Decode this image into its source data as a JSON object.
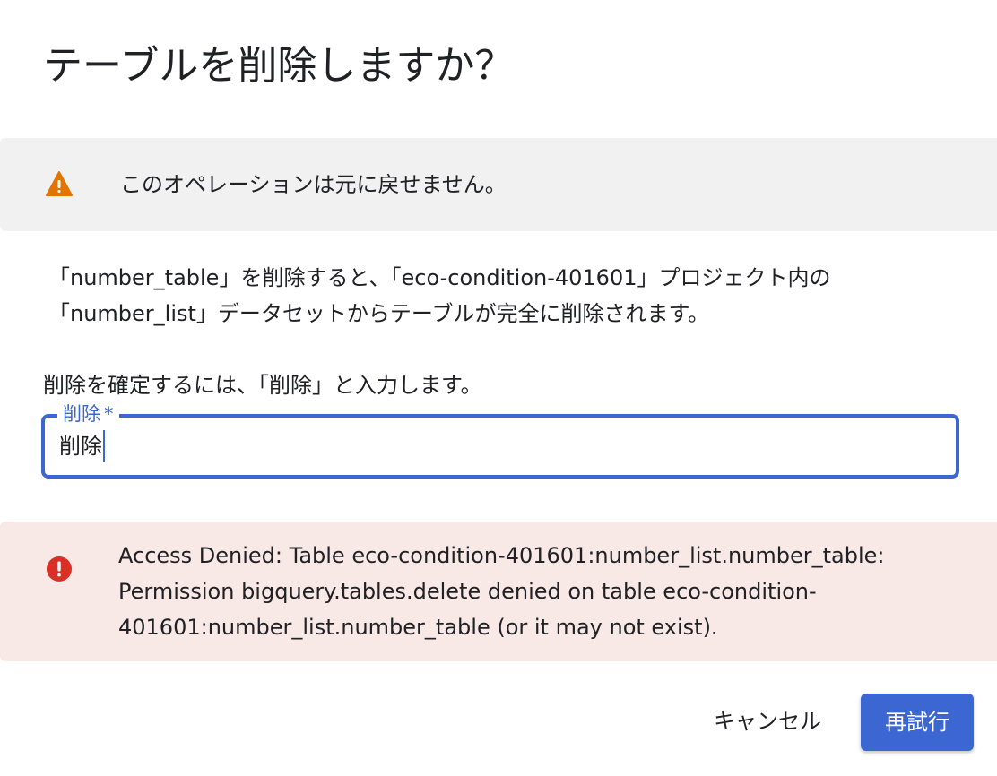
{
  "dialog": {
    "title": "テーブルを削除しますか？"
  },
  "warning": {
    "icon": "warning-icon",
    "color": "#e37400",
    "text": "このオペレーションは元に戻せません。"
  },
  "description": {
    "line1": "「number_table」を削除すると、「eco-condition-401601」プロジェクト内の",
    "line2": "「number_list」データセットからテーブルが完全に削除されます。"
  },
  "confirm": {
    "instruction": "削除を確定するには、「削除」と入力します。",
    "input_label": "削除",
    "required_marker": "*",
    "input_value": "削除"
  },
  "error": {
    "icon": "error-icon",
    "color": "#d93025",
    "line1": "Access Denied: Table eco-condition-401601:number_list.number_table:",
    "line2": "Permission bigquery.tables.delete denied on table eco-condition-",
    "line3": "401601:number_list.number_table (or it may not exist)."
  },
  "actions": {
    "cancel_label": "キャンセル",
    "retry_label": "再試行",
    "accent_color": "#3c66d1"
  }
}
